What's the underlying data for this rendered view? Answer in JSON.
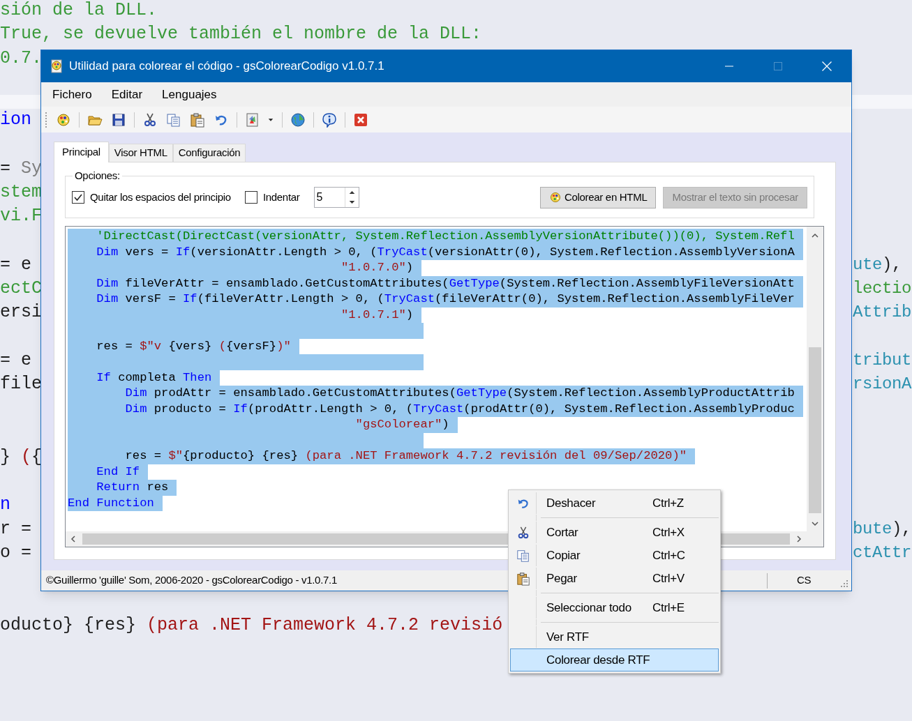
{
  "background_editor": {
    "lines": [
      {
        "left": [
          {
            "text": "sión de la DLL.",
            "kind": "comment"
          }
        ]
      },
      {
        "left": [
          {
            "text": "True, se devuelve también el nombre de la DLL:",
            "kind": "comment"
          }
        ]
      },
      {
        "left": [
          {
            "text": "0.7.",
            "kind": "comment"
          }
        ]
      },
      {
        "left": [
          {
            "text": "ion",
            "kind": "keyword"
          }
        ]
      },
      {
        "left": [
          {
            "text": "= ",
            "kind": "plain"
          },
          {
            "text": "Sy",
            "kind": "gray"
          }
        ]
      },
      {
        "left": [
          {
            "text": "stem",
            "kind": "comment"
          }
        ]
      },
      {
        "left": [
          {
            "text": "vi.F",
            "kind": "comment"
          }
        ]
      },
      {
        "left": [
          {
            "text": "= e",
            "kind": "plain"
          }
        ],
        "right": [
          {
            "text": "ute",
            "kind": "type"
          },
          {
            "text": "),",
            "kind": "plain"
          }
        ]
      },
      {
        "left": [
          {
            "text": "ectC",
            "kind": "comment"
          }
        ],
        "right": [
          {
            "text": "lectio",
            "kind": "comment"
          }
        ]
      },
      {
        "left": [
          {
            "text": "ersi",
            "kind": "plain"
          }
        ],
        "right": [
          {
            "text": "Attrib",
            "kind": "type"
          }
        ]
      },
      {
        "left": [
          {
            "text": "= e",
            "kind": "plain"
          }
        ],
        "right": [
          {
            "text": "tribut",
            "kind": "type"
          }
        ]
      },
      {
        "left": [
          {
            "text": "file",
            "kind": "plain"
          }
        ],
        "right": [
          {
            "text": "rsionA",
            "kind": "type"
          }
        ]
      },
      {
        "left": [
          {
            "text": "} ",
            "kind": "plain"
          },
          {
            "text": "(",
            "kind": "string"
          },
          {
            "text": "{",
            "kind": "plain"
          }
        ]
      },
      {
        "left": [
          {
            "text": "n",
            "kind": "keyword"
          }
        ]
      },
      {
        "left": [
          {
            "text": "r =",
            "kind": "plain"
          }
        ],
        "right": [
          {
            "text": "bute",
            "kind": "type"
          },
          {
            "text": "),",
            "kind": "plain"
          }
        ]
      },
      {
        "left": [
          {
            "text": "o =",
            "kind": "plain"
          }
        ],
        "right": [
          {
            "text": "ctAttr",
            "kind": "type"
          }
        ]
      },
      {
        "left": [
          {
            "text": "oducto} {res} ",
            "kind": "plain"
          },
          {
            "text": "(para .NET Framework 4.7.2 revisió",
            "kind": "string"
          }
        ]
      }
    ]
  },
  "window": {
    "title": "Utilidad para colorear el código - gsColorearCodigo v1.0.7.1",
    "controls": [
      {
        "kind": "minimize",
        "disabled": false
      },
      {
        "kind": "maximize",
        "disabled": true
      },
      {
        "kind": "close",
        "disabled": false
      }
    ]
  },
  "menu_bar": [
    "Fichero",
    "Editar",
    "Lenguajes"
  ],
  "toolbar": [
    {
      "kind": "palette"
    },
    {
      "kind": "separator"
    },
    {
      "kind": "open"
    },
    {
      "kind": "save"
    },
    {
      "kind": "separator"
    },
    {
      "kind": "cut"
    },
    {
      "kind": "copy"
    },
    {
      "kind": "paste"
    },
    {
      "kind": "undo"
    },
    {
      "kind": "separator"
    },
    {
      "kind": "document"
    },
    {
      "kind": "dropdown"
    },
    {
      "kind": "separator"
    },
    {
      "kind": "globe"
    },
    {
      "kind": "separator"
    },
    {
      "kind": "info"
    },
    {
      "kind": "separator"
    },
    {
      "kind": "close"
    }
  ],
  "tabs": [
    {
      "label": "Principal",
      "selected": true
    },
    {
      "label": "Visor HTML",
      "selected": false
    },
    {
      "label": "Configuración",
      "selected": false
    }
  ],
  "options": {
    "title": "Opciones:",
    "checkboxes": [
      {
        "label": "Quitar los espacios del principio",
        "checked": true
      },
      {
        "label": "Indentar",
        "checked": false
      }
    ],
    "indent_value": "5",
    "buttons": [
      {
        "label": "Colorear en HTML",
        "disabled": false
      },
      {
        "label": "Mostrar el texto sin procesar",
        "disabled": true
      }
    ]
  },
  "code_editor": {
    "lines": [
      {
        "selected": true,
        "segments": [
          {
            "text": "    'DirectCast(DirectCast(versionAttr, System.Reflection.AssemblyVersionAttribute())(0), System.Refl",
            "kind": "comment"
          }
        ]
      },
      {
        "selected": true,
        "segments": [
          {
            "text": "    Dim",
            "kind": "keyword"
          },
          {
            "text": " vers = ",
            "kind": "plain"
          },
          {
            "text": "If",
            "kind": "keyword"
          },
          {
            "text": "(versionAttr.Length > 0, (",
            "kind": "plain"
          },
          {
            "text": "TryCast",
            "kind": "keyword"
          },
          {
            "text": "(versionAttr(0), System.Reflection.AssemblyVersionA",
            "kind": "plain"
          }
        ]
      },
      {
        "selected": true,
        "segments": [
          {
            "text": "                                      \"1.0.7.0\"",
            "kind": "string"
          },
          {
            "text": ")",
            "kind": "plain"
          }
        ]
      },
      {
        "selected": true,
        "segments": [
          {
            "text": "    Dim",
            "kind": "keyword"
          },
          {
            "text": " fileVerAttr = ensamblado.GetCustomAttributes(",
            "kind": "plain"
          },
          {
            "text": "GetType",
            "kind": "keyword"
          },
          {
            "text": "(System.Reflection.AssemblyFileVersionAtt",
            "kind": "plain"
          }
        ]
      },
      {
        "selected": true,
        "segments": [
          {
            "text": "    Dim",
            "kind": "keyword"
          },
          {
            "text": " versF = ",
            "kind": "plain"
          },
          {
            "text": "If",
            "kind": "keyword"
          },
          {
            "text": "(fileVerAttr.Length > 0, (",
            "kind": "plain"
          },
          {
            "text": "TryCast",
            "kind": "keyword"
          },
          {
            "text": "(fileVerAttr(0), System.Reflection.AssemblyFileVer",
            "kind": "plain"
          }
        ]
      },
      {
        "selected": true,
        "segments": [
          {
            "text": "                                      \"1.0.7.1\"",
            "kind": "string"
          },
          {
            "text": ")",
            "kind": "plain"
          }
        ]
      },
      {
        "selected": true,
        "kind": "blank"
      },
      {
        "selected": true,
        "segments": [
          {
            "text": "    res = ",
            "kind": "plain"
          },
          {
            "text": "$\"v ",
            "kind": "string"
          },
          {
            "text": "{vers}",
            "kind": "plain"
          },
          {
            "text": " (",
            "kind": "string"
          },
          {
            "text": "{versF}",
            "kind": "plain"
          },
          {
            "text": ")\"",
            "kind": "string"
          }
        ]
      },
      {
        "selected": true,
        "kind": "blank"
      },
      {
        "selected": true,
        "segments": [
          {
            "text": "    If",
            "kind": "keyword"
          },
          {
            "text": " completa ",
            "kind": "plain"
          },
          {
            "text": "Then",
            "kind": "keyword"
          }
        ]
      },
      {
        "selected": true,
        "segments": [
          {
            "text": "        Dim",
            "kind": "keyword"
          },
          {
            "text": " prodAttr = ensamblado.GetCustomAttributes(",
            "kind": "plain"
          },
          {
            "text": "GetType",
            "kind": "keyword"
          },
          {
            "text": "(System.Reflection.AssemblyProductAttrib",
            "kind": "plain"
          }
        ]
      },
      {
        "selected": true,
        "segments": [
          {
            "text": "        Dim",
            "kind": "keyword"
          },
          {
            "text": " producto = ",
            "kind": "plain"
          },
          {
            "text": "If",
            "kind": "keyword"
          },
          {
            "text": "(prodAttr.Length > 0, (",
            "kind": "plain"
          },
          {
            "text": "TryCast",
            "kind": "keyword"
          },
          {
            "text": "(prodAttr(0), System.Reflection.AssemblyProduc",
            "kind": "plain"
          }
        ]
      },
      {
        "selected": true,
        "segments": [
          {
            "text": "                                        \"gsColorear\"",
            "kind": "string"
          },
          {
            "text": ")",
            "kind": "plain"
          }
        ]
      },
      {
        "selected": true,
        "kind": "blank"
      },
      {
        "selected": true,
        "segments": [
          {
            "text": "        res = ",
            "kind": "plain"
          },
          {
            "text": "$\"",
            "kind": "string"
          },
          {
            "text": "{producto} {res}",
            "kind": "plain"
          },
          {
            "text": " (para .NET Framework 4.7.2 revisión del 09/Sep/2020)\"",
            "kind": "string"
          }
        ]
      },
      {
        "selected": true,
        "segments": [
          {
            "text": "    End If",
            "kind": "keyword"
          }
        ]
      },
      {
        "selected": true,
        "segments": [
          {
            "text": "    Return",
            "kind": "keyword"
          },
          {
            "text": " res",
            "kind": "plain"
          }
        ]
      },
      {
        "selected": true,
        "segments": [
          {
            "text": "End Function",
            "kind": "keyword"
          }
        ]
      }
    ]
  },
  "status_bar": {
    "text": "©Guillermo 'guille' Som, 2006-2020 - gsColorearCodigo - v1.0.7.1",
    "language": "CS"
  },
  "context_menu": {
    "items": [
      {
        "kind": "item",
        "label": "Deshacer",
        "shortcut": "Ctrl+Z",
        "selected": false
      },
      {
        "kind": "separator"
      },
      {
        "kind": "item",
        "label": "Cortar",
        "shortcut": "Ctrl+X",
        "selected": false
      },
      {
        "kind": "item",
        "label": "Copiar",
        "shortcut": "Ctrl+C",
        "selected": false
      },
      {
        "kind": "item",
        "label": "Pegar",
        "shortcut": "Ctrl+V",
        "selected": false
      },
      {
        "kind": "separator"
      },
      {
        "kind": "item",
        "label": "Seleccionar todo",
        "shortcut": "Ctrl+E",
        "selected": false
      },
      {
        "kind": "separator"
      },
      {
        "kind": "item",
        "label": "Ver RTF",
        "selected": false
      },
      {
        "kind": "item",
        "label": "Colorear desde RTF",
        "selected": true
      }
    ]
  }
}
